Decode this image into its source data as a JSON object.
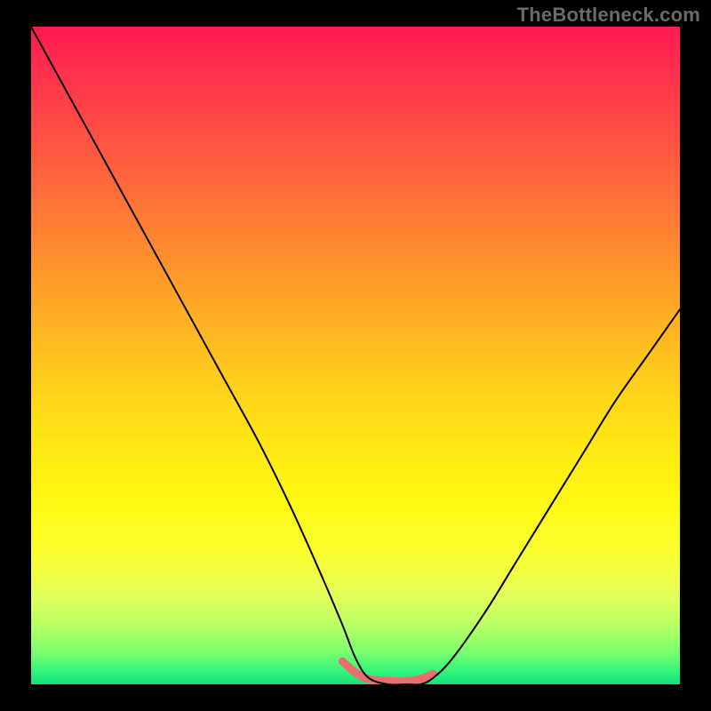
{
  "watermark": "TheBottleneck.com",
  "chart_data": {
    "type": "line",
    "title": "",
    "xlabel": "",
    "ylabel": "",
    "xlim": [
      0,
      100
    ],
    "ylim": [
      0,
      100
    ],
    "gradient_stops": [
      {
        "pos": 0,
        "color": "#ff1a52"
      },
      {
        "pos": 10,
        "color": "#ff3a4a"
      },
      {
        "pos": 25,
        "color": "#ff6c3a"
      },
      {
        "pos": 38,
        "color": "#ff9a2a"
      },
      {
        "pos": 52,
        "color": "#ffc81e"
      },
      {
        "pos": 62,
        "color": "#ffe414"
      },
      {
        "pos": 72,
        "color": "#fff812"
      },
      {
        "pos": 80,
        "color": "#fbff30"
      },
      {
        "pos": 86,
        "color": "#e8ff58"
      },
      {
        "pos": 91,
        "color": "#b8ff64"
      },
      {
        "pos": 95,
        "color": "#7dff6e"
      },
      {
        "pos": 98,
        "color": "#34f57a"
      },
      {
        "pos": 100,
        "color": "#14e07a"
      }
    ],
    "series": [
      {
        "name": "thin-black-curve",
        "color": "#000000",
        "width": 2,
        "x": [
          0,
          5,
          10,
          15,
          20,
          25,
          30,
          35,
          40,
          45,
          48,
          50,
          52,
          55,
          58,
          60,
          62,
          65,
          70,
          75,
          80,
          85,
          90,
          95,
          100
        ],
        "y": [
          100,
          91,
          82,
          73,
          64,
          55,
          46,
          37,
          27,
          16,
          9,
          4,
          1,
          0,
          0,
          0,
          1,
          4,
          11,
          19,
          27,
          35,
          43,
          50,
          57
        ]
      },
      {
        "name": "thick-pink-segment",
        "color": "#eb6e6e",
        "width": 9,
        "x": [
          48,
          50,
          52,
          55,
          58,
          60,
          62
        ],
        "y": [
          3.5,
          1.8,
          0.8,
          0.5,
          0.5,
          0.8,
          1.6
        ]
      }
    ]
  }
}
